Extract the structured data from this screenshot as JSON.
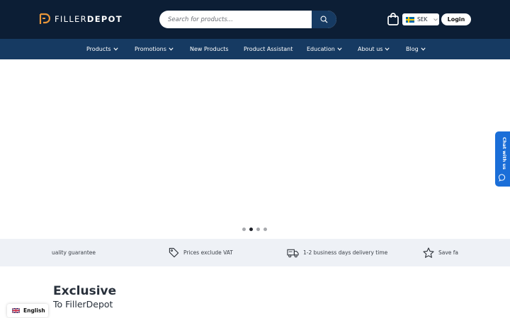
{
  "brand": {
    "logo_thin": "FILLER",
    "logo_bold": "DEPOT",
    "accent": "#e8963a"
  },
  "colors": {
    "topbar": "#0c1e35",
    "navbar": "#163a62",
    "chat": "#1a6ed8",
    "usp_bg": "#eef1f6"
  },
  "search": {
    "placeholder": "Search for products...",
    "icon": "search-icon"
  },
  "header": {
    "cart_icon": "shopping-bag-icon",
    "currency": "SEK",
    "login_label": "Login"
  },
  "nav": {
    "items": [
      {
        "label": "Products",
        "dropdown": true
      },
      {
        "label": "Promotions",
        "dropdown": true
      },
      {
        "label": "New Products",
        "dropdown": false
      },
      {
        "label": "Product Assistant",
        "dropdown": false
      },
      {
        "label": "Education",
        "dropdown": true
      },
      {
        "label": "About us",
        "dropdown": true
      },
      {
        "label": "Blog",
        "dropdown": true
      }
    ]
  },
  "carousel": {
    "slide_count": 4,
    "active_index": 1
  },
  "chat": {
    "label": "Chat with us"
  },
  "usp": {
    "items": [
      {
        "text": "uality guarantee",
        "icon": "none"
      },
      {
        "text": "Prices exclude VAT",
        "icon": "tag-icon"
      },
      {
        "text": "1-2 business days delivery time",
        "icon": "truck-icon"
      },
      {
        "text": "Save fa",
        "icon": "star-icon"
      }
    ]
  },
  "exclusive": {
    "title": "Exclusive",
    "subtitle": "To FillerDepot"
  },
  "language": {
    "label": "English"
  }
}
